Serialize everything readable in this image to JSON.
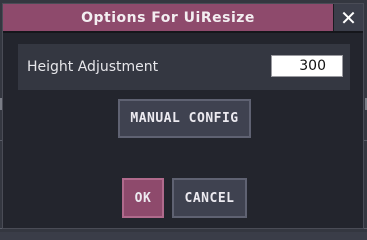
{
  "dialog": {
    "title": "Options For UiResize",
    "close_label": "✕"
  },
  "setting": {
    "label": "Height Adjustment",
    "value": "300"
  },
  "buttons": {
    "manual_config": "MANUAL CONFIG",
    "ok": "OK",
    "cancel": "CANCEL"
  },
  "colors": {
    "accent": "#8e4a6c",
    "panel": "#23252d",
    "row": "#343741",
    "button": "#3f4250"
  }
}
